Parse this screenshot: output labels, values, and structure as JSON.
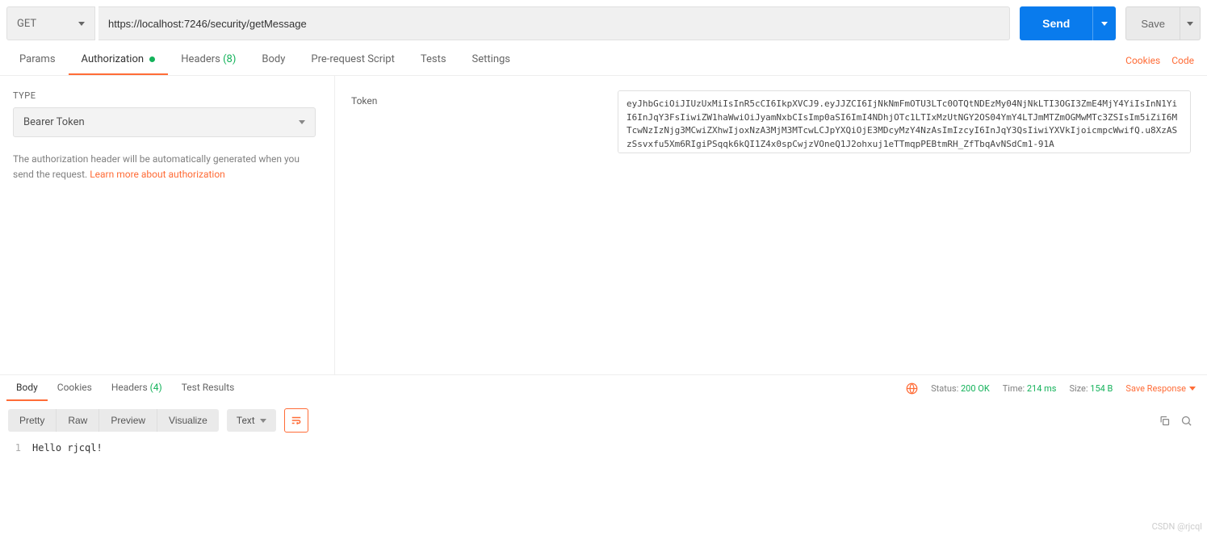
{
  "request": {
    "method": "GET",
    "url": "https://localhost:7246/security/getMessage",
    "send_label": "Send",
    "save_label": "Save"
  },
  "tabs": {
    "params": "Params",
    "auth": "Authorization",
    "headers_label": "Headers",
    "headers_count": "(8)",
    "body": "Body",
    "prerequest": "Pre-request Script",
    "tests": "Tests",
    "settings": "Settings"
  },
  "right_links": {
    "cookies": "Cookies",
    "code": "Code"
  },
  "auth": {
    "type_label": "TYPE",
    "type_value": "Bearer Token",
    "help_text_prefix": "The authorization header will be automatically generated when you send the request. ",
    "help_link": "Learn more about authorization",
    "token_label": "Token",
    "token_value": "eyJhbGciOiJIUzUxMiIsInR5cCI6IkpXVCJ9.eyJJZCI6IjNkNmFmOTU3LTc0OTQtNDEzMy04NjNkLTI3OGI3ZmE4MjY4YiIsInN1YiI6InJqY3FsIiwiZW1haWwiOiJyamNxbCIsImp0aSI6ImI4NDhjOTc1LTIxMzUtNGY2OS04YmY4LTJmMTZmOGMwMTc3ZSIsIm5iZiI6MTcwNzIzNjg3MCwiZXhwIjoxNzA3MjM3MTcwLCJpYXQiOjE3MDcyMzY4NzAsImIzcyI6InJqY3QsIiwiYXVkIjoicmpcWwifQ.u8XzASzSsvxfu5Xm6RIgiPSqqk6kQI1Z4x0spCwjzVOneQ1J2ohxuj1eTTmqpPEBtmRH_ZfTbqAvNSdCm1-91A"
  },
  "response": {
    "tabs": {
      "body": "Body",
      "cookies": "Cookies",
      "headers_label": "Headers",
      "headers_count": "(4)",
      "tests": "Test Results"
    },
    "status_label": "Status:",
    "status_value": "200 OK",
    "time_label": "Time:",
    "time_value": "214 ms",
    "size_label": "Size:",
    "size_value": "154 B",
    "save_response": "Save Response"
  },
  "viewer": {
    "pretty": "Pretty",
    "raw": "Raw",
    "preview": "Preview",
    "visualize": "Visualize",
    "format": "Text",
    "line_no": "1",
    "body_text": "Hello rjcql!"
  },
  "watermark": "CSDN @rjcql"
}
